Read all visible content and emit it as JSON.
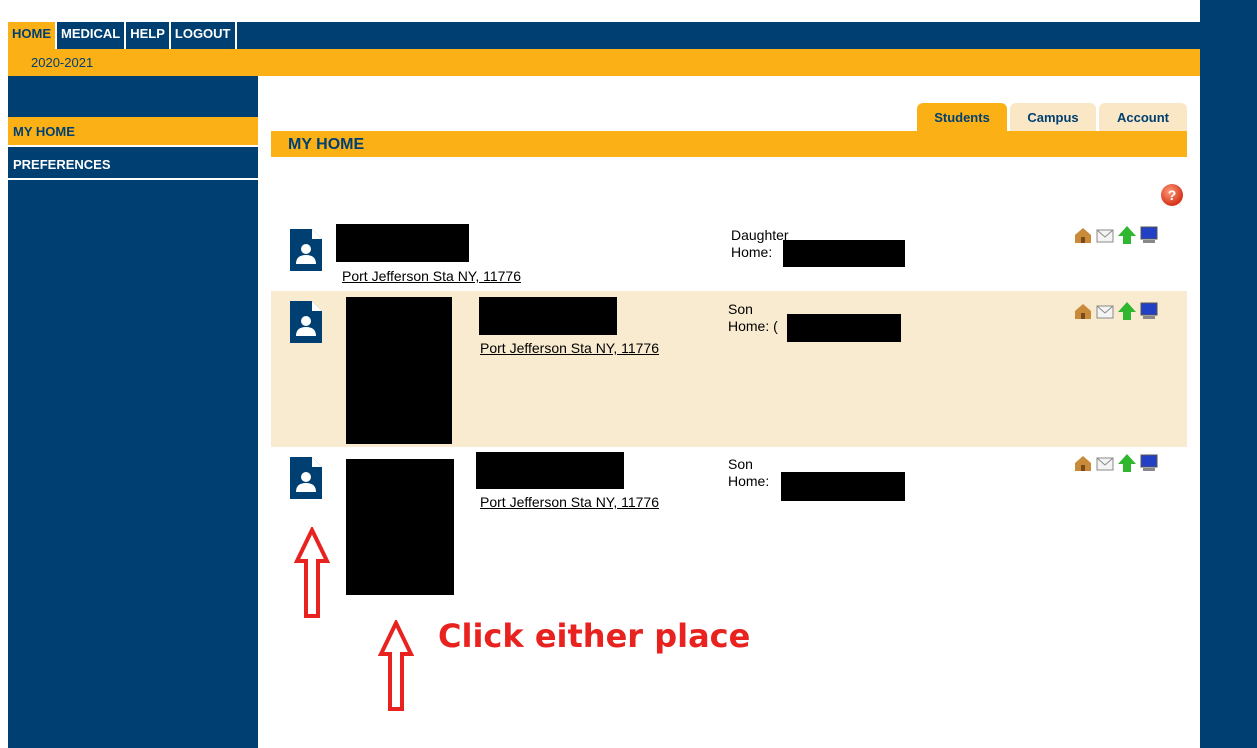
{
  "topnav": {
    "items": [
      {
        "label": "HOME",
        "active": true
      },
      {
        "label": "MEDICAL",
        "active": false
      },
      {
        "label": "HELP",
        "active": false
      },
      {
        "label": "LOGOUT",
        "active": false
      }
    ]
  },
  "school_year": "2020-2021",
  "sidebar": {
    "items": [
      {
        "label": "MY HOME",
        "active": true
      },
      {
        "label": "PREFERENCES",
        "active": false
      }
    ]
  },
  "tabs": [
    {
      "label": "Students",
      "active": true
    },
    {
      "label": "Campus",
      "active": false
    },
    {
      "label": "Account",
      "active": false
    }
  ],
  "page_title": "MY HOME",
  "students": [
    {
      "address": "Port Jefferson Sta NY, 11776",
      "relation": "Daughter",
      "home_label": "Home:"
    },
    {
      "address": "Port Jefferson Sta NY, 11776",
      "relation": "Son",
      "home_label": "Home: ("
    },
    {
      "address": "Port Jefferson Sta NY, 11776",
      "relation": "Son",
      "home_label": "Home:"
    }
  ],
  "annotation": {
    "text": "Click either place"
  },
  "colors": {
    "navy": "#003f72",
    "gold": "#fbb116",
    "row_alt": "#f9ebd0",
    "annotation": "#e8231f"
  }
}
